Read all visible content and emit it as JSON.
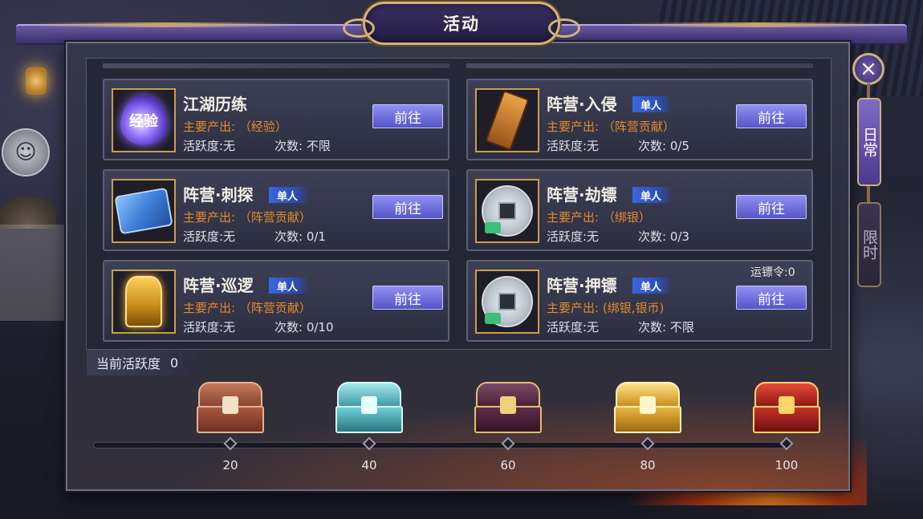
{
  "window": {
    "title": "活动"
  },
  "side_tabs": [
    {
      "label": "日常",
      "active": true
    },
    {
      "label": "限时",
      "active": false
    }
  ],
  "activities": [
    {
      "name": "江湖历练",
      "badge": "",
      "output": "主要产出: （经验）",
      "activity": "活跃度:无",
      "count": "次数: 不限",
      "go": "前往",
      "extra": "",
      "icon": "exp-orb-icon",
      "icon_text": "经验"
    },
    {
      "name": "阵营·入侵",
      "badge": "单人",
      "output": "主要产出: （阵营贡献）",
      "activity": "活跃度:无",
      "count": "次数: 0/5",
      "go": "前往",
      "extra": "",
      "icon": "faction-token-icon",
      "icon_text": ""
    },
    {
      "name": "阵营·刺探",
      "badge": "单人",
      "output": "主要产出: （阵营贡献）",
      "activity": "活跃度:无",
      "count": "次数: 0/1",
      "go": "前往",
      "extra": "",
      "icon": "scroll-icon",
      "icon_text": ""
    },
    {
      "name": "阵营·劫镖",
      "badge": "单人",
      "output": "主要产出: （绑银）",
      "activity": "活跃度:无",
      "count": "次数: 0/3",
      "go": "前往",
      "extra": "",
      "icon": "silver-coin-icon",
      "icon_text": ""
    },
    {
      "name": "阵营·巡逻",
      "badge": "单人",
      "output": "主要产出: （阵营贡献）",
      "activity": "活跃度:无",
      "count": "次数: 0/10",
      "go": "前往",
      "extra": "",
      "icon": "golden-gong-icon",
      "icon_text": ""
    },
    {
      "name": "阵营·押镖",
      "badge": "单人",
      "output": "主要产出: (绑银,银币)",
      "activity": "活跃度:无",
      "count": "次数: 不限",
      "go": "前往",
      "extra": "运镖令:0",
      "icon": "silver-coin-icon",
      "icon_text": ""
    }
  ],
  "progress": {
    "label": "当前活跃度",
    "value": "0",
    "current": 0,
    "max": 100,
    "milestones": [
      "20",
      "40",
      "60",
      "80",
      "100"
    ],
    "chests": [
      "wooden-chest-icon",
      "crystal-chest-icon",
      "purple-chest-icon",
      "gold-chest-icon",
      "red-gold-chest-icon"
    ]
  },
  "colors": {
    "accent": "#5555c8",
    "output_text": "#e58a2b",
    "frame_gold": "#c99d4e"
  }
}
